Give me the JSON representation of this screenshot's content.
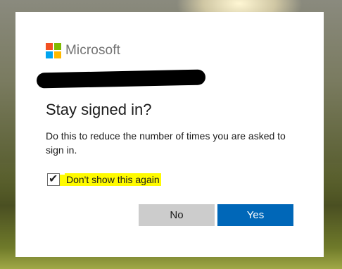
{
  "brand": {
    "name": "Microsoft",
    "logo_colors": [
      "#f25022",
      "#7fba00",
      "#00a4ef",
      "#ffb900"
    ]
  },
  "dialog": {
    "title": "Stay signed in?",
    "description": "Do this to reduce the number of times you are asked to sign in.",
    "checkbox": {
      "label": "Don't show this again",
      "checked": true,
      "highlight_color": "#fffb00"
    }
  },
  "buttons": {
    "no_label": "No",
    "yes_label": "Yes"
  },
  "colors": {
    "primary": "#0067b8",
    "secondary_button": "#cccccc",
    "redaction": "#000000"
  }
}
